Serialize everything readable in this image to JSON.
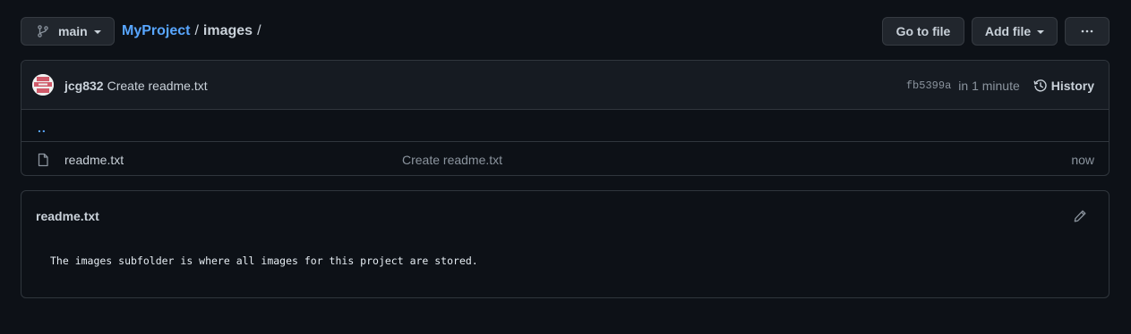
{
  "toolbar": {
    "branch_label": "main",
    "go_to_file_label": "Go to file",
    "add_file_label": "Add file",
    "more_label": "···"
  },
  "breadcrumb": {
    "repo": "MyProject",
    "separator": "/",
    "folder": "images",
    "trailing_separator": "/"
  },
  "commit": {
    "author": "jcg832",
    "message": "Create readme.txt",
    "sha": "fb5399a",
    "time": "in 1 minute",
    "history_label": "History"
  },
  "listing": {
    "parent_link": "..",
    "files": [
      {
        "name": "readme.txt",
        "commit_message": "Create readme.txt",
        "age": "now",
        "icon": "file-icon"
      }
    ]
  },
  "readme": {
    "title": "readme.txt",
    "body": "The images subfolder is where all images for this project are stored."
  },
  "colors": {
    "background": "#0d1117",
    "link": "#58a6ff",
    "border": "#30363d",
    "muted_text": "#8b949e"
  }
}
